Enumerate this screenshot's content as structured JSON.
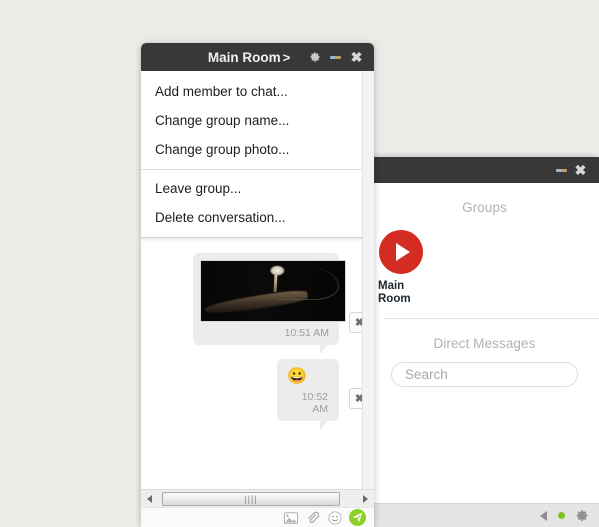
{
  "chat_window": {
    "title": "Main Room",
    "title_chevron": ">",
    "titlebar_icons": [
      "gear-icon",
      "minimize-icon",
      "close-icon"
    ],
    "menu": {
      "group_one": [
        "Add member to chat...",
        "Change group name...",
        "Change group photo..."
      ],
      "group_two": [
        "Leave group...",
        "Delete conversation..."
      ]
    },
    "messages": [
      {
        "type": "image",
        "alt": "dark photo of a white mushroom on a branch",
        "time": "10:51 AM",
        "delete_label": "✖"
      },
      {
        "type": "emoji",
        "content": "😀",
        "time": "10:52 AM",
        "delete_label": "✖"
      }
    ],
    "scrollbar": {
      "left_arrow": "◂",
      "right_arrow": "▸",
      "grip": "||||"
    },
    "toolbar_icons": [
      "image-icon",
      "paperclip-icon",
      "emoji-icon",
      "send-icon"
    ]
  },
  "contacts_window": {
    "titlebar_icons": [
      "minimize-icon",
      "close-icon"
    ],
    "close_glyph": "✖",
    "groups": {
      "heading": "Groups",
      "items": [
        {
          "name": "Main Room",
          "avatar": "play-icon",
          "avatar_color": "#d42b22"
        }
      ]
    },
    "direct_messages": {
      "heading": "Direct Messages",
      "search_placeholder": "Search",
      "search_value": ""
    },
    "statusbar": {
      "speaker_icon": "speaker-icon",
      "status_dot_color": "#80c422",
      "gear_icon": "gear-icon"
    }
  },
  "theme": {
    "desktop_background": "#edebe7",
    "titlebar": "#383838",
    "accent_send": "#8ed126",
    "bubble": "#ececec"
  }
}
